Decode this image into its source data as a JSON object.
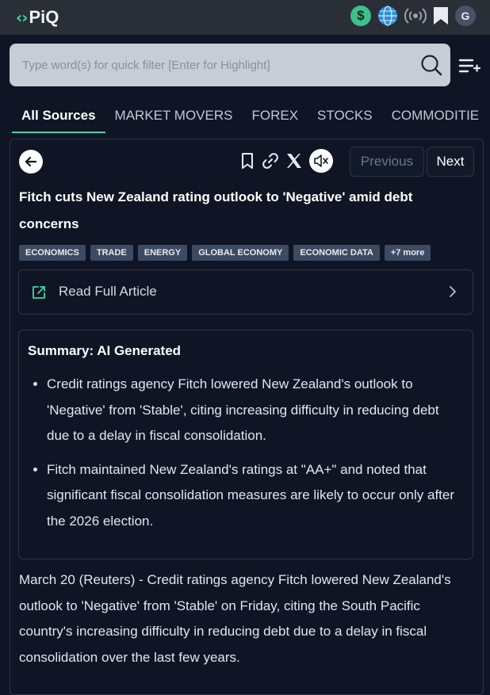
{
  "app": {
    "logo_text": "PiQ"
  },
  "topbar": {
    "avatar_initial": "G"
  },
  "search": {
    "placeholder": "Type word(s) for quick filter [Enter for Highlight]"
  },
  "tabs": [
    "All Sources",
    "MARKET MOVERS",
    "FOREX",
    "STOCKS",
    "COMMODITIE"
  ],
  "article": {
    "nav": {
      "previous": "Previous",
      "next": "Next"
    },
    "headline": "Fitch cuts New Zealand rating outlook to 'Negative' amid debt concerns",
    "tags": [
      "ECONOMICS",
      "TRADE",
      "ENERGY",
      "GLOBAL ECONOMY",
      "ECONOMIC DATA",
      "+7 more"
    ],
    "read_full": "Read Full Article",
    "summary": {
      "title": "Summary: AI Generated",
      "bullets": [
        "Credit ratings agency Fitch lowered New Zealand's outlook to 'Negative' from 'Stable', citing increasing difficulty in reducing debt due to a delay in fiscal consolidation.",
        "Fitch maintained New Zealand's ratings at \"AA+\" and noted that significant fiscal consolidation measures are likely to occur only after the 2026 election."
      ]
    },
    "body": "March 20 (Reuters) - Credit ratings agency Fitch lowered New Zealand's outlook to 'Negative' from 'Stable' on Friday, citing the South Pacific country's increasing difficulty in reducing debt due to a delay in fiscal consolidation over the last few years."
  },
  "colors": {
    "accent": "#3fd6a8",
    "background": "#0f1524",
    "topbar": "#2a2e37",
    "tag_bg": "#3c4a62"
  },
  "icons": [
    "dollar-icon",
    "globe-icon",
    "radio-signal-icon",
    "bookmark-icon",
    "search-icon",
    "menu-icon",
    "back-arrow-icon",
    "link-icon",
    "x-icon",
    "mute-icon",
    "external-link-icon",
    "chevron-right-icon"
  ]
}
